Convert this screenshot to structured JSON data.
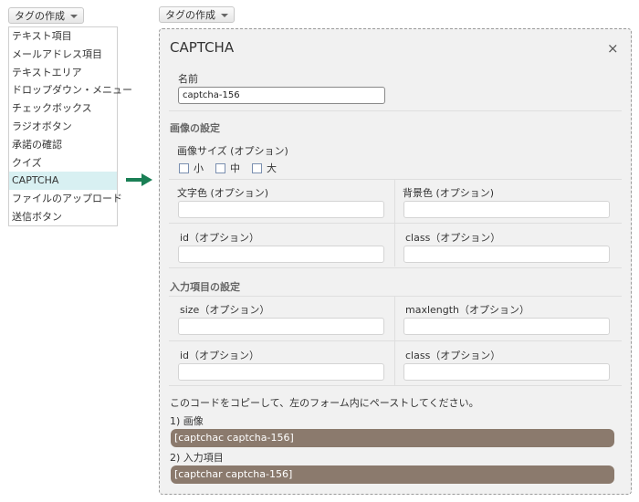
{
  "left": {
    "button_label": "タグの作成",
    "menu_items": [
      "テキスト項目",
      "メールアドレス項目",
      "テキストエリア",
      "ドロップダウン・メニュー",
      "チェックボックス",
      "ラジオボタン",
      "承諾の確認",
      "クイズ",
      "CAPTCHA",
      "ファイルのアップロード",
      "送信ボタン"
    ],
    "active_item": "CAPTCHA"
  },
  "arrow_color": "#1a7f55",
  "right": {
    "button_label": "タグの作成",
    "panel": {
      "title": "CAPTCHA",
      "close": "×",
      "name_label": "名前",
      "name_value": "captcha-156",
      "image_section_title": "画像の設定",
      "image_size_label": "画像サイズ (オプション)",
      "sizes": [
        "小",
        "中",
        "大"
      ],
      "fg_color_label": "文字色 (オプション)",
      "bg_color_label": "背景色 (オプション)",
      "id_label": "id（オプション）",
      "class_label": "class（オプション）",
      "input_section_title": "入力項目の設定",
      "size_label": "size（オプション）",
      "maxlength_label": "maxlength（オプション）",
      "id2_label": "id（オプション）",
      "class2_label": "class（オプション）",
      "copy_instruction": "このコードをコピーして、左のフォーム内にペーストしてください。",
      "code1_label": "1) 画像",
      "code1": "[captchac captcha-156]",
      "code2_label": "2) 入力項目",
      "code2": "[captchar captcha-156]"
    }
  }
}
